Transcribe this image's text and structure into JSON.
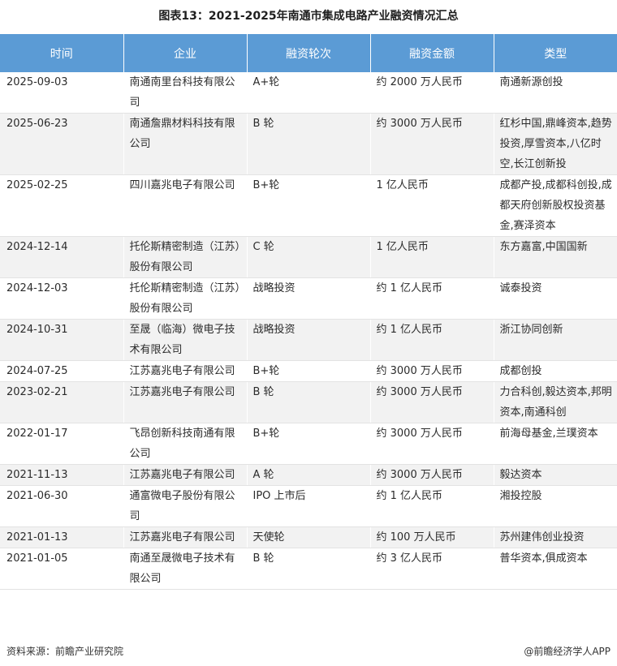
{
  "title": "图表13：2021-2025年南通市集成电路产业融资情况汇总",
  "columns": [
    "时间",
    "企业",
    "融资轮次",
    "融资金额",
    "类型"
  ],
  "rows": [
    {
      "date": "2025-09-03",
      "company": "南通南里台科技有限公司",
      "round": "A+轮",
      "amount": "约 2000 万人民币",
      "investor": "南通新源创投"
    },
    {
      "date": "2025-06-23",
      "company": "南通詹鼎材料科技有限公司",
      "round": "B 轮",
      "amount": "约 3000 万人民币",
      "investor": "红杉中国,鼎峰资本,趋势投资,厚雪资本,八亿时空,长江创新投"
    },
    {
      "date": "2025-02-25",
      "company": "四川嘉兆电子有限公司",
      "round": "B+轮",
      "amount": "1 亿人民币",
      "investor": "成都产投,成都科创投,成都天府创新股权投资基金,赛泽资本"
    },
    {
      "date": "2024-12-14",
      "company": "托伦斯精密制造（江苏）股份有限公司",
      "round": "C 轮",
      "amount": "1 亿人民币",
      "investor": "东方嘉富,中国国新"
    },
    {
      "date": "2024-12-03",
      "company": "托伦斯精密制造（江苏）股份有限公司",
      "round": "战略投资",
      "amount": "约 1 亿人民币",
      "investor": "诚泰投资"
    },
    {
      "date": "2024-10-31",
      "company": "至晟（临海）微电子技术有限公司",
      "round": "战略投资",
      "amount": "约 1 亿人民币",
      "investor": "浙江协同创新"
    },
    {
      "date": "2024-07-25",
      "company": "江苏嘉兆电子有限公司",
      "round": "B+轮",
      "amount": "约 3000 万人民币",
      "investor": "成都创投"
    },
    {
      "date": "2023-02-21",
      "company": "江苏嘉兆电子有限公司",
      "round": "B 轮",
      "amount": "约 3000 万人民币",
      "investor": "力合科创,毅达资本,邦明资本,南通科创"
    },
    {
      "date": "2022-01-17",
      "company": "飞昂创新科技南通有限公司",
      "round": "B+轮",
      "amount": "约 3000 万人民币",
      "investor": "前海母基金,兰璞资本"
    },
    {
      "date": "2021-11-13",
      "company": "江苏嘉兆电子有限公司",
      "round": "A 轮",
      "amount": "约 3000 万人民币",
      "investor": "毅达资本"
    },
    {
      "date": "2021-06-30",
      "company": "通富微电子股份有限公司",
      "round": "IPO 上市后",
      "amount": "约 1 亿人民币",
      "investor": "湘投控股"
    },
    {
      "date": "2021-01-13",
      "company": "江苏嘉兆电子有限公司",
      "round": "天使轮",
      "amount": "约 100 万人民币",
      "investor": "苏州建伟创业投资"
    },
    {
      "date": "2021-01-05",
      "company": "南通至晟微电子技术有限公司",
      "round": "B 轮",
      "amount": "约 3 亿人民币",
      "investor": "普华资本,俱成资本"
    }
  ],
  "footer": {
    "source": "资料来源：前瞻产业研究院",
    "brand": "@前瞻经济学人APP"
  }
}
